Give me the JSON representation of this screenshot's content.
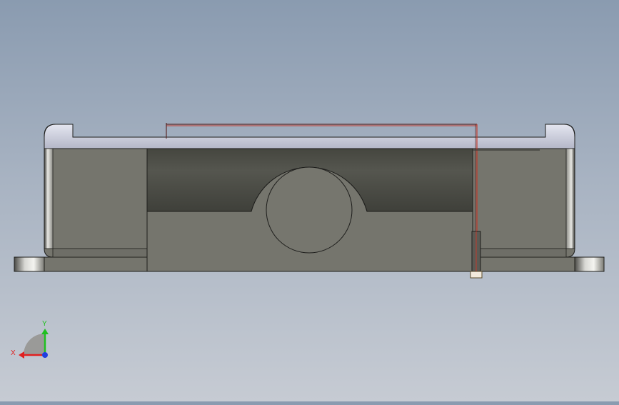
{
  "viewport": {
    "background_top": "#8a9bb0",
    "background_bottom": "#c6cbd3",
    "part_face_color": "#75756d",
    "part_dark_color": "#4f504b",
    "rim_color": "#c8cbd8",
    "wire_color": "#c0392b"
  },
  "triad": {
    "x_label": "X",
    "y_label": "Y",
    "x_color": "#e02020",
    "y_color": "#20c020",
    "z_color": "#2040e0"
  }
}
